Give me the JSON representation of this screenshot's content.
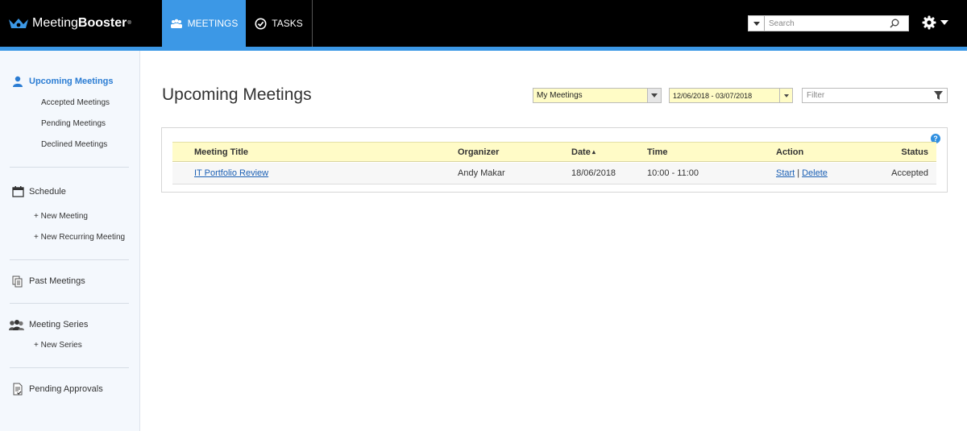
{
  "header": {
    "brand_light": "Meeting",
    "brand_bold": "Booster",
    "brand_mark": "®",
    "tabs": [
      {
        "label": "MEETINGS",
        "icon": "group-icon",
        "active": true
      },
      {
        "label": "TASKS",
        "icon": "check-circle-icon",
        "active": false
      }
    ],
    "search_placeholder": "Search",
    "accent_color": "#3c98e6"
  },
  "sidebar": {
    "sections": [
      {
        "label": "Upcoming Meetings",
        "icon": "person-icon",
        "active": true,
        "sub": [
          "Accepted Meetings",
          "Pending Meetings",
          "Declined Meetings"
        ]
      },
      {
        "label": "Schedule",
        "icon": "calendar-icon",
        "sub": [
          "+ New Meeting",
          "+ New Recurring Meeting"
        ]
      },
      {
        "label": "Past Meetings",
        "icon": "documents-icon",
        "sub": []
      },
      {
        "label": "Meeting Series",
        "icon": "people-icon",
        "sub": [
          "+ New Series"
        ]
      },
      {
        "label": "Pending Approvals",
        "icon": "approval-document-icon",
        "sub": []
      }
    ]
  },
  "main": {
    "title": "Upcoming Meetings",
    "meetings_filter": "My Meetings",
    "date_range": "12/06/2018 - 03/07/2018",
    "filter_placeholder": "Filter",
    "help_label": "?",
    "table": {
      "columns": [
        "Meeting Title",
        "Organizer",
        "Date",
        "Time",
        "Action",
        "Status"
      ],
      "sort_indicator": "▴",
      "rows": [
        {
          "title": "IT Portfolio Review",
          "organizer": "Andy Makar",
          "date": "18/06/2018",
          "time": "10:00 - 11:00",
          "action_start": "Start",
          "action_sep": "|",
          "action_delete": "Delete",
          "status": "Accepted"
        }
      ]
    }
  }
}
